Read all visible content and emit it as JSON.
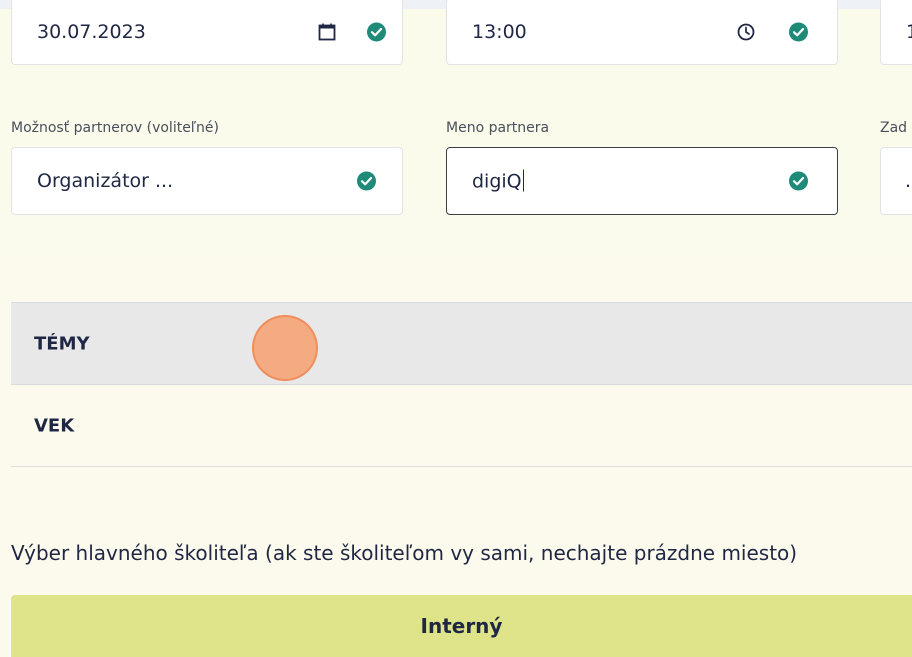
{
  "row1": {
    "date_value": "30.07.2023",
    "time_value": "13:00",
    "third_value": "1"
  },
  "row2": {
    "partner_option_label": "Možnosť partnerov (voliteľné)",
    "partner_option_value": "Organizátor ...",
    "partner_name_label": "Meno partnera",
    "partner_name_value": "digiQ",
    "third_label": "Zad",
    "third_value": "."
  },
  "accordion": {
    "temy_label": "TÉMY",
    "vek_label": "VEK"
  },
  "trainer": {
    "description": "Výber hlavného školiteľa (ak ste školiteľom vy sami, nechajte prázdne miesto)",
    "button_label": "Interný"
  },
  "icons": {
    "date": "calendar-icon",
    "time": "clock-icon",
    "valid": "check-circle-icon"
  },
  "colors": {
    "check": "#1e8a78",
    "primary_button": "#dfe38a",
    "text": "#1f2744"
  }
}
